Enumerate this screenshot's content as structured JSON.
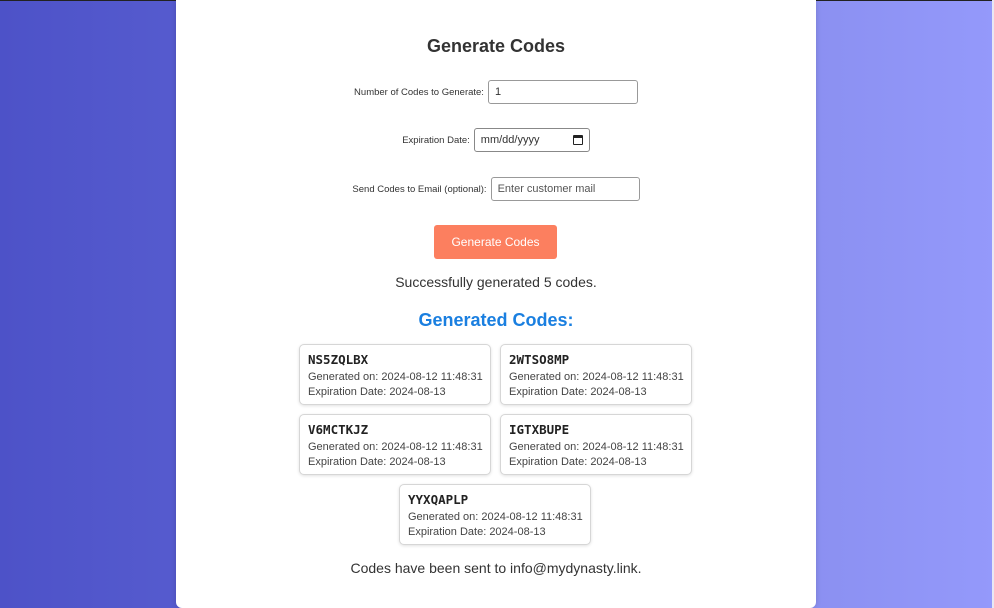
{
  "form": {
    "title": "Generate Codes",
    "count_label": "Number of Codes to Generate:",
    "count_value": "1",
    "expiration_label": "Expiration Date:",
    "expiration_placeholder": "mm/dd/yyyy",
    "email_label": "Send Codes to Email (optional):",
    "email_placeholder": "Enter customer mail",
    "generate_button": "Generate Codes"
  },
  "status": {
    "success_message": "Successfully generated 5 codes.",
    "sent_message": "Codes have been sent to info@mydynasty.link."
  },
  "results": {
    "heading": "Generated Codes:",
    "codes": [
      {
        "code": "NS5ZQLBX",
        "generated": "Generated on: 2024-08-12 11:48:31",
        "expiration": "Expiration Date: 2024-08-13"
      },
      {
        "code": "2WTSO8MP",
        "generated": "Generated on: 2024-08-12 11:48:31",
        "expiration": "Expiration Date: 2024-08-13"
      },
      {
        "code": "V6MCTKJZ",
        "generated": "Generated on: 2024-08-12 11:48:31",
        "expiration": "Expiration Date: 2024-08-13"
      },
      {
        "code": "IGTXBUPE",
        "generated": "Generated on: 2024-08-12 11:48:31",
        "expiration": "Expiration Date: 2024-08-13"
      },
      {
        "code": "YYXQAPLP",
        "generated": "Generated on: 2024-08-12 11:48:31",
        "expiration": "Expiration Date: 2024-08-13"
      }
    ]
  },
  "colors": {
    "button": "#fc7f5f",
    "heading_accent": "#1a7fe0",
    "background_start": "#4d52c8",
    "background_end": "#9499fb"
  }
}
